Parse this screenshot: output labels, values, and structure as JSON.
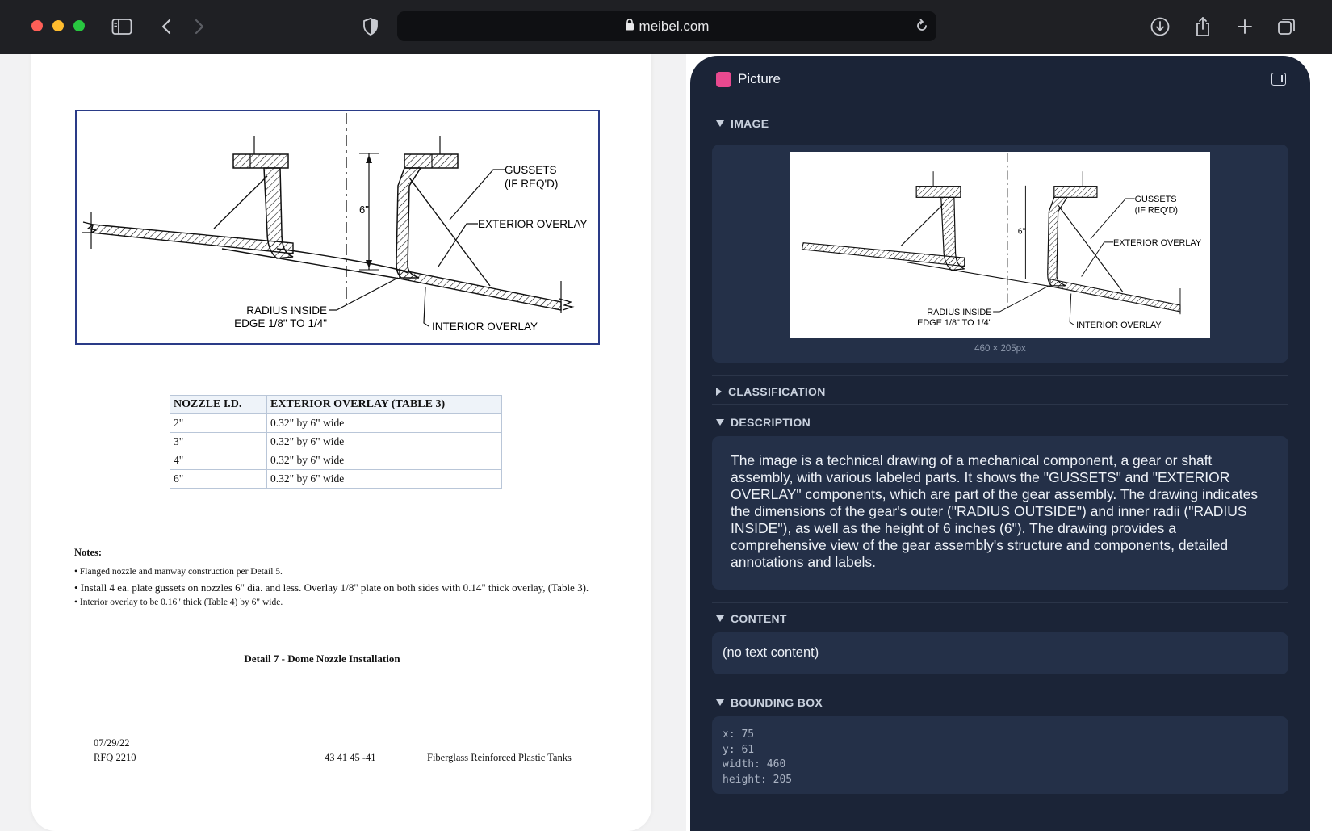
{
  "browser": {
    "url": "meibel.com",
    "icons": [
      "sidebar-icon",
      "back-icon",
      "forward-icon",
      "shield-icon",
      "lock-icon",
      "reload-icon",
      "download-icon",
      "share-icon",
      "plus-icon",
      "tabs-icon"
    ]
  },
  "document": {
    "drawing_labels": {
      "gussets": "GUSSETS",
      "gussets_sub": "(IF REQ'D)",
      "exterior": "EXTERIOR OVERLAY",
      "dim": "6\"",
      "radius1": "RADIUS INSIDE",
      "radius2": "EDGE 1/8\" TO 1/4\"",
      "interior": "INTERIOR OVERLAY"
    },
    "table": {
      "headers": [
        "NOZZLE I.D.",
        "EXTERIOR OVERLAY (TABLE 3)"
      ],
      "rows": [
        [
          "2\"",
          "0.32\" by 6\" wide"
        ],
        [
          "3\"",
          "0.32\" by 6\" wide"
        ],
        [
          "4\"",
          "0.32\" by 6\" wide"
        ],
        [
          "6\"",
          "0.32\" by 6\" wide"
        ]
      ]
    },
    "notes_title": "Notes:",
    "notes": [
      "• Flanged nozzle and manway construction per Detail 5.",
      "• Install 4 ea. plate gussets on nozzles 6\" dia. and less. Overlay 1/8\" plate on both sides with 0.14\" thick overlay, (Table 3).",
      "• Interior overlay to be 0.16\" thick (Table 4) by 6\" wide."
    ],
    "caption": "Detail 7 - Dome Nozzle Installation",
    "footer": {
      "date": "07/29/22",
      "rfq": "RFQ 2210",
      "code": "43 41 45 -41",
      "title": "Fiberglass Reinforced Plastic Tanks"
    }
  },
  "panel": {
    "title": "Picture",
    "swatch_color": "#e8498f",
    "sections": {
      "image": "IMAGE",
      "classification": "CLASSIFICATION",
      "description": "DESCRIPTION",
      "content": "CONTENT",
      "bounding_box": "BOUNDING BOX"
    },
    "image_size": "460 × 205px",
    "description": "The image is a technical drawing of a mechanical component, a gear or shaft assembly, with various labeled parts. It shows the \"GUSSETS\" and \"EXTERIOR OVERLAY\" components, which are part of the gear assembly. The drawing indicates the dimensions of the gear's outer (\"RADIUS OUTSIDE\") and inner radii (\"RADIUS INSIDE\"), as well as the height of 6 inches (6\"). The drawing provides a comprehensive view of the gear assembly's structure and components, detailed annotations and labels.",
    "content": "(no text content)",
    "bbox": {
      "x": "x: 75",
      "y": "y: 61",
      "width": "width: 460",
      "height": "height: 205"
    }
  }
}
